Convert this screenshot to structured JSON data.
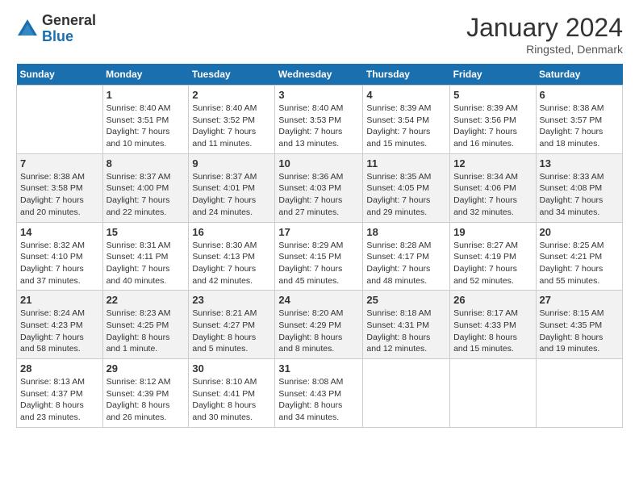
{
  "logo": {
    "general": "General",
    "blue": "Blue"
  },
  "title": "January 2024",
  "location": "Ringsted, Denmark",
  "days_header": [
    "Sunday",
    "Monday",
    "Tuesday",
    "Wednesday",
    "Thursday",
    "Friday",
    "Saturday"
  ],
  "weeks": [
    [
      {
        "day": "",
        "content": ""
      },
      {
        "day": "1",
        "content": "Sunrise: 8:40 AM\nSunset: 3:51 PM\nDaylight: 7 hours\nand 10 minutes."
      },
      {
        "day": "2",
        "content": "Sunrise: 8:40 AM\nSunset: 3:52 PM\nDaylight: 7 hours\nand 11 minutes."
      },
      {
        "day": "3",
        "content": "Sunrise: 8:40 AM\nSunset: 3:53 PM\nDaylight: 7 hours\nand 13 minutes."
      },
      {
        "day": "4",
        "content": "Sunrise: 8:39 AM\nSunset: 3:54 PM\nDaylight: 7 hours\nand 15 minutes."
      },
      {
        "day": "5",
        "content": "Sunrise: 8:39 AM\nSunset: 3:56 PM\nDaylight: 7 hours\nand 16 minutes."
      },
      {
        "day": "6",
        "content": "Sunrise: 8:38 AM\nSunset: 3:57 PM\nDaylight: 7 hours\nand 18 minutes."
      }
    ],
    [
      {
        "day": "7",
        "content": "Sunrise: 8:38 AM\nSunset: 3:58 PM\nDaylight: 7 hours\nand 20 minutes."
      },
      {
        "day": "8",
        "content": "Sunrise: 8:37 AM\nSunset: 4:00 PM\nDaylight: 7 hours\nand 22 minutes."
      },
      {
        "day": "9",
        "content": "Sunrise: 8:37 AM\nSunset: 4:01 PM\nDaylight: 7 hours\nand 24 minutes."
      },
      {
        "day": "10",
        "content": "Sunrise: 8:36 AM\nSunset: 4:03 PM\nDaylight: 7 hours\nand 27 minutes."
      },
      {
        "day": "11",
        "content": "Sunrise: 8:35 AM\nSunset: 4:05 PM\nDaylight: 7 hours\nand 29 minutes."
      },
      {
        "day": "12",
        "content": "Sunrise: 8:34 AM\nSunset: 4:06 PM\nDaylight: 7 hours\nand 32 minutes."
      },
      {
        "day": "13",
        "content": "Sunrise: 8:33 AM\nSunset: 4:08 PM\nDaylight: 7 hours\nand 34 minutes."
      }
    ],
    [
      {
        "day": "14",
        "content": "Sunrise: 8:32 AM\nSunset: 4:10 PM\nDaylight: 7 hours\nand 37 minutes."
      },
      {
        "day": "15",
        "content": "Sunrise: 8:31 AM\nSunset: 4:11 PM\nDaylight: 7 hours\nand 40 minutes."
      },
      {
        "day": "16",
        "content": "Sunrise: 8:30 AM\nSunset: 4:13 PM\nDaylight: 7 hours\nand 42 minutes."
      },
      {
        "day": "17",
        "content": "Sunrise: 8:29 AM\nSunset: 4:15 PM\nDaylight: 7 hours\nand 45 minutes."
      },
      {
        "day": "18",
        "content": "Sunrise: 8:28 AM\nSunset: 4:17 PM\nDaylight: 7 hours\nand 48 minutes."
      },
      {
        "day": "19",
        "content": "Sunrise: 8:27 AM\nSunset: 4:19 PM\nDaylight: 7 hours\nand 52 minutes."
      },
      {
        "day": "20",
        "content": "Sunrise: 8:25 AM\nSunset: 4:21 PM\nDaylight: 7 hours\nand 55 minutes."
      }
    ],
    [
      {
        "day": "21",
        "content": "Sunrise: 8:24 AM\nSunset: 4:23 PM\nDaylight: 7 hours\nand 58 minutes."
      },
      {
        "day": "22",
        "content": "Sunrise: 8:23 AM\nSunset: 4:25 PM\nDaylight: 8 hours\nand 1 minute."
      },
      {
        "day": "23",
        "content": "Sunrise: 8:21 AM\nSunset: 4:27 PM\nDaylight: 8 hours\nand 5 minutes."
      },
      {
        "day": "24",
        "content": "Sunrise: 8:20 AM\nSunset: 4:29 PM\nDaylight: 8 hours\nand 8 minutes."
      },
      {
        "day": "25",
        "content": "Sunrise: 8:18 AM\nSunset: 4:31 PM\nDaylight: 8 hours\nand 12 minutes."
      },
      {
        "day": "26",
        "content": "Sunrise: 8:17 AM\nSunset: 4:33 PM\nDaylight: 8 hours\nand 15 minutes."
      },
      {
        "day": "27",
        "content": "Sunrise: 8:15 AM\nSunset: 4:35 PM\nDaylight: 8 hours\nand 19 minutes."
      }
    ],
    [
      {
        "day": "28",
        "content": "Sunrise: 8:13 AM\nSunset: 4:37 PM\nDaylight: 8 hours\nand 23 minutes."
      },
      {
        "day": "29",
        "content": "Sunrise: 8:12 AM\nSunset: 4:39 PM\nDaylight: 8 hours\nand 26 minutes."
      },
      {
        "day": "30",
        "content": "Sunrise: 8:10 AM\nSunset: 4:41 PM\nDaylight: 8 hours\nand 30 minutes."
      },
      {
        "day": "31",
        "content": "Sunrise: 8:08 AM\nSunset: 4:43 PM\nDaylight: 8 hours\nand 34 minutes."
      },
      {
        "day": "",
        "content": ""
      },
      {
        "day": "",
        "content": ""
      },
      {
        "day": "",
        "content": ""
      }
    ]
  ]
}
